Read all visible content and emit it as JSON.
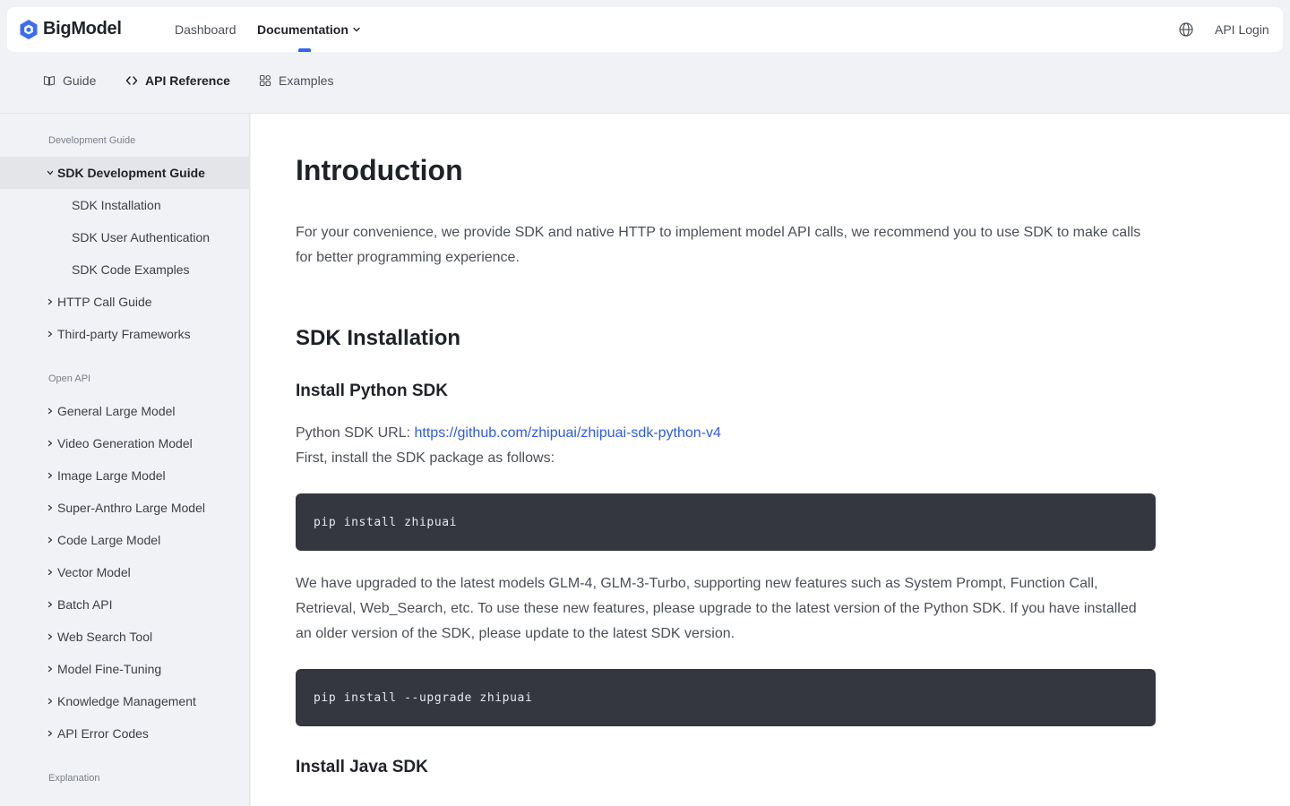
{
  "header": {
    "brand": "BigModel",
    "nav": {
      "dashboard": "Dashboard",
      "documentation": "Documentation"
    },
    "login": "API Login"
  },
  "subtabs": {
    "guide": "Guide",
    "api_reference": "API Reference",
    "examples": "Examples"
  },
  "sidebar": {
    "sections": {
      "development_guide": "Development Guide",
      "open_api": "Open API",
      "explanation": "Explanation"
    },
    "items": [
      {
        "label": "SDK Development Guide"
      },
      {
        "label": "SDK Installation"
      },
      {
        "label": "SDK User Authentication"
      },
      {
        "label": "SDK Code Examples"
      },
      {
        "label": "HTTP Call Guide"
      },
      {
        "label": "Third-party Frameworks"
      },
      {
        "label": "General Large Model"
      },
      {
        "label": "Video Generation Model"
      },
      {
        "label": "Image Large Model"
      },
      {
        "label": "Super-Anthro Large Model"
      },
      {
        "label": "Code Large Model"
      },
      {
        "label": "Vector Model"
      },
      {
        "label": "Batch API"
      },
      {
        "label": "Web Search Tool"
      },
      {
        "label": "Model Fine-Tuning"
      },
      {
        "label": "Knowledge Management"
      },
      {
        "label": "API Error Codes"
      }
    ]
  },
  "content": {
    "title": "Introduction",
    "intro": "For your convenience, we provide SDK and native HTTP to implement model API calls, we recommend you to use SDK to make calls for better programming experience.",
    "sdk_installation": "SDK Installation",
    "python_title": "Install Python SDK",
    "python_url_label": "Python SDK URL: ",
    "python_url": "https://github.com/zhipuai/zhipuai-sdk-python-v4",
    "python_install_note": "First, install the SDK package as follows:",
    "code_install": "pip install zhipuai",
    "upgrade_note": "We have upgraded to the latest models GLM-4, GLM-3-Turbo, supporting new features such as System Prompt, Function Call, Retrieval, Web_Search, etc. To use these new features, please upgrade to the latest version of the Python SDK. If you have installed an older version of the SDK, please update to the latest SDK version.",
    "code_upgrade": "pip install --upgrade zhipuai",
    "java_title": "Install Java SDK"
  },
  "colors": {
    "accent": "#3365ee",
    "link": "#2e5ce6",
    "code_bg": "#343640"
  }
}
